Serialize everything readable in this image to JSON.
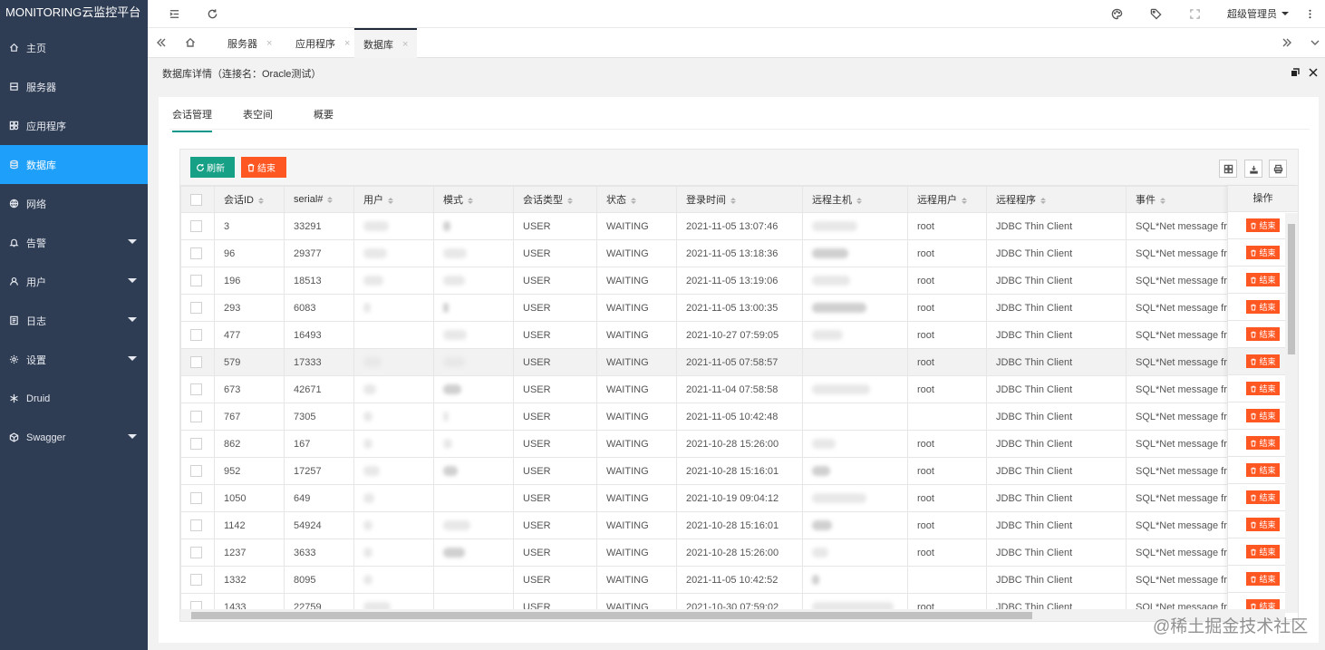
{
  "app": {
    "title": "MONITORING云监控平台"
  },
  "sidebar": {
    "items": [
      {
        "label": "主页",
        "icon": "home-icon"
      },
      {
        "label": "服务器",
        "icon": "server-icon"
      },
      {
        "label": "应用程序",
        "icon": "apps-icon"
      },
      {
        "label": "数据库",
        "icon": "database-icon",
        "active": true
      },
      {
        "label": "网络",
        "icon": "globe-icon"
      },
      {
        "label": "告警",
        "icon": "bell-icon",
        "expandable": true
      },
      {
        "label": "用户",
        "icon": "user-icon",
        "expandable": true
      },
      {
        "label": "日志",
        "icon": "log-icon",
        "expandable": true
      },
      {
        "label": "设置",
        "icon": "gear-icon",
        "expandable": true
      },
      {
        "label": "Druid",
        "icon": "snowflake-icon"
      },
      {
        "label": "Swagger",
        "icon": "cube-icon",
        "expandable": true
      }
    ]
  },
  "header": {
    "user": "超级管理员"
  },
  "page_tabs": [
    {
      "label": "服务器",
      "closable": true
    },
    {
      "label": "应用程序",
      "closable": true
    },
    {
      "label": "数据库",
      "closable": true,
      "active": true
    }
  ],
  "detail": {
    "title": "数据库详情（连接名：Oracle测试）",
    "tabs": [
      "会话管理",
      "表空间",
      "概要"
    ],
    "active_tab": "会话管理"
  },
  "toolbar": {
    "refresh_label": "刷新",
    "kill_label": "结束"
  },
  "table": {
    "columns": [
      "会话ID",
      "serial#",
      "用户",
      "模式",
      "会话类型",
      "状态",
      "登录时间",
      "远程主机",
      "远程用户",
      "远程程序",
      "事件"
    ],
    "op_header": "操作",
    "op_label": "结束",
    "rows": [
      {
        "sid": "3",
        "serial": "33291",
        "type": "USER",
        "status": "WAITING",
        "login": "2021-11-05 13:07:46",
        "ruser": "root",
        "program": "JDBC Thin Client",
        "event": "SQL*Net message fr"
      },
      {
        "sid": "96",
        "serial": "29377",
        "type": "USER",
        "status": "WAITING",
        "login": "2021-11-05 13:18:36",
        "ruser": "root",
        "program": "JDBC Thin Client",
        "event": "SQL*Net message fr"
      },
      {
        "sid": "196",
        "serial": "18513",
        "type": "USER",
        "status": "WAITING",
        "login": "2021-11-05 13:19:06",
        "ruser": "root",
        "program": "JDBC Thin Client",
        "event": "SQL*Net message fr"
      },
      {
        "sid": "293",
        "serial": "6083",
        "type": "USER",
        "status": "WAITING",
        "login": "2021-11-05 13:00:35",
        "ruser": "root",
        "program": "JDBC Thin Client",
        "event": "SQL*Net message fr"
      },
      {
        "sid": "477",
        "serial": "16493",
        "type": "USER",
        "status": "WAITING",
        "login": "2021-10-27 07:59:05",
        "ruser": "root",
        "program": "JDBC Thin Client",
        "event": "SQL*Net message fr"
      },
      {
        "sid": "579",
        "serial": "17333",
        "type": "USER",
        "status": "WAITING",
        "login": "2021-11-05 07:58:57",
        "ruser": "root",
        "program": "JDBC Thin Client",
        "event": "SQL*Net message fr",
        "highlight": true
      },
      {
        "sid": "673",
        "serial": "42671",
        "type": "USER",
        "status": "WAITING",
        "login": "2021-11-04 07:58:58",
        "ruser": "root",
        "program": "JDBC Thin Client",
        "event": "SQL*Net message fr"
      },
      {
        "sid": "767",
        "serial": "7305",
        "type": "USER",
        "status": "WAITING",
        "login": "2021-11-05 10:42:48",
        "ruser": "",
        "program": "JDBC Thin Client",
        "event": "SQL*Net message fr"
      },
      {
        "sid": "862",
        "serial": "167",
        "type": "USER",
        "status": "WAITING",
        "login": "2021-10-28 15:26:00",
        "ruser": "root",
        "program": "JDBC Thin Client",
        "event": "SQL*Net message fr"
      },
      {
        "sid": "952",
        "serial": "17257",
        "type": "USER",
        "status": "WAITING",
        "login": "2021-10-28 15:16:01",
        "ruser": "root",
        "program": "JDBC Thin Client",
        "event": "SQL*Net message fr"
      },
      {
        "sid": "1050",
        "serial": "649",
        "type": "USER",
        "status": "WAITING",
        "login": "2021-10-19 09:04:12",
        "ruser": "root",
        "program": "JDBC Thin Client",
        "event": "SQL*Net message fr"
      },
      {
        "sid": "1142",
        "serial": "54924",
        "type": "USER",
        "status": "WAITING",
        "login": "2021-10-28 15:16:01",
        "ruser": "root",
        "program": "JDBC Thin Client",
        "event": "SQL*Net message fr"
      },
      {
        "sid": "1237",
        "serial": "3633",
        "type": "USER",
        "status": "WAITING",
        "login": "2021-10-28 15:26:00",
        "ruser": "root",
        "program": "JDBC Thin Client",
        "event": "SQL*Net message fr"
      },
      {
        "sid": "1332",
        "serial": "8095",
        "type": "USER",
        "status": "WAITING",
        "login": "2021-11-05 10:42:52",
        "ruser": "",
        "program": "JDBC Thin Client",
        "event": "SQL*Net message fr"
      },
      {
        "sid": "1433",
        "serial": "22759",
        "type": "USER",
        "status": "WAITING",
        "login": "2021-10-30 07:59:02",
        "ruser": "root",
        "program": "JDBC Thin Client",
        "event": "SQL*Net message fr"
      }
    ]
  },
  "watermark": "@稀土掘金技术社区",
  "colors": {
    "sidebar_bg": "#2f3d54",
    "active_nav": "#1ea0fa",
    "refresh_btn": "#16a085",
    "kill_btn": "#ff5722",
    "tab_underline": "#009688"
  }
}
